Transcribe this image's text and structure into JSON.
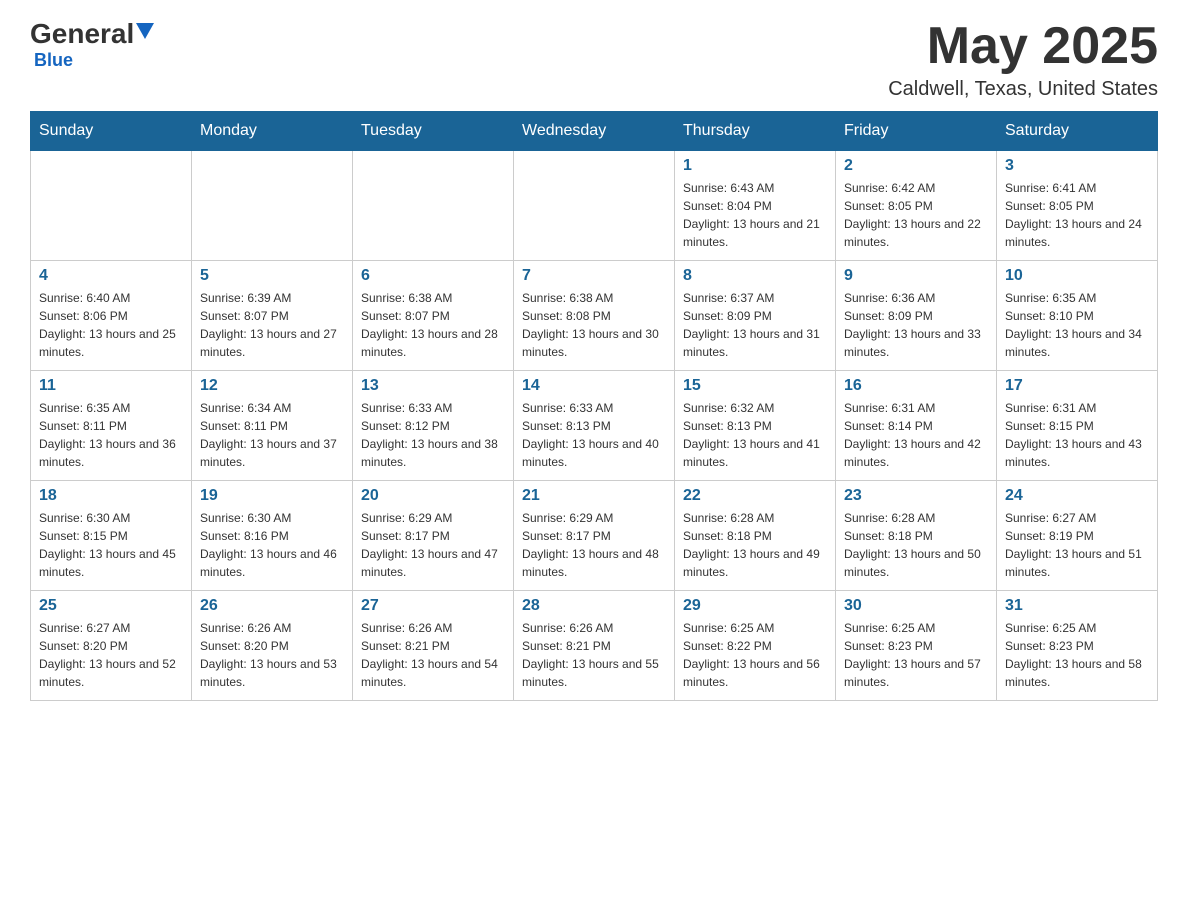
{
  "header": {
    "logo_general": "General",
    "logo_blue": "Blue",
    "month_title": "May 2025",
    "location": "Caldwell, Texas, United States"
  },
  "days_of_week": [
    "Sunday",
    "Monday",
    "Tuesday",
    "Wednesday",
    "Thursday",
    "Friday",
    "Saturday"
  ],
  "weeks": [
    [
      {
        "day": "",
        "info": ""
      },
      {
        "day": "",
        "info": ""
      },
      {
        "day": "",
        "info": ""
      },
      {
        "day": "",
        "info": ""
      },
      {
        "day": "1",
        "info": "Sunrise: 6:43 AM\nSunset: 8:04 PM\nDaylight: 13 hours and 21 minutes."
      },
      {
        "day": "2",
        "info": "Sunrise: 6:42 AM\nSunset: 8:05 PM\nDaylight: 13 hours and 22 minutes."
      },
      {
        "day": "3",
        "info": "Sunrise: 6:41 AM\nSunset: 8:05 PM\nDaylight: 13 hours and 24 minutes."
      }
    ],
    [
      {
        "day": "4",
        "info": "Sunrise: 6:40 AM\nSunset: 8:06 PM\nDaylight: 13 hours and 25 minutes."
      },
      {
        "day": "5",
        "info": "Sunrise: 6:39 AM\nSunset: 8:07 PM\nDaylight: 13 hours and 27 minutes."
      },
      {
        "day": "6",
        "info": "Sunrise: 6:38 AM\nSunset: 8:07 PM\nDaylight: 13 hours and 28 minutes."
      },
      {
        "day": "7",
        "info": "Sunrise: 6:38 AM\nSunset: 8:08 PM\nDaylight: 13 hours and 30 minutes."
      },
      {
        "day": "8",
        "info": "Sunrise: 6:37 AM\nSunset: 8:09 PM\nDaylight: 13 hours and 31 minutes."
      },
      {
        "day": "9",
        "info": "Sunrise: 6:36 AM\nSunset: 8:09 PM\nDaylight: 13 hours and 33 minutes."
      },
      {
        "day": "10",
        "info": "Sunrise: 6:35 AM\nSunset: 8:10 PM\nDaylight: 13 hours and 34 minutes."
      }
    ],
    [
      {
        "day": "11",
        "info": "Sunrise: 6:35 AM\nSunset: 8:11 PM\nDaylight: 13 hours and 36 minutes."
      },
      {
        "day": "12",
        "info": "Sunrise: 6:34 AM\nSunset: 8:11 PM\nDaylight: 13 hours and 37 minutes."
      },
      {
        "day": "13",
        "info": "Sunrise: 6:33 AM\nSunset: 8:12 PM\nDaylight: 13 hours and 38 minutes."
      },
      {
        "day": "14",
        "info": "Sunrise: 6:33 AM\nSunset: 8:13 PM\nDaylight: 13 hours and 40 minutes."
      },
      {
        "day": "15",
        "info": "Sunrise: 6:32 AM\nSunset: 8:13 PM\nDaylight: 13 hours and 41 minutes."
      },
      {
        "day": "16",
        "info": "Sunrise: 6:31 AM\nSunset: 8:14 PM\nDaylight: 13 hours and 42 minutes."
      },
      {
        "day": "17",
        "info": "Sunrise: 6:31 AM\nSunset: 8:15 PM\nDaylight: 13 hours and 43 minutes."
      }
    ],
    [
      {
        "day": "18",
        "info": "Sunrise: 6:30 AM\nSunset: 8:15 PM\nDaylight: 13 hours and 45 minutes."
      },
      {
        "day": "19",
        "info": "Sunrise: 6:30 AM\nSunset: 8:16 PM\nDaylight: 13 hours and 46 minutes."
      },
      {
        "day": "20",
        "info": "Sunrise: 6:29 AM\nSunset: 8:17 PM\nDaylight: 13 hours and 47 minutes."
      },
      {
        "day": "21",
        "info": "Sunrise: 6:29 AM\nSunset: 8:17 PM\nDaylight: 13 hours and 48 minutes."
      },
      {
        "day": "22",
        "info": "Sunrise: 6:28 AM\nSunset: 8:18 PM\nDaylight: 13 hours and 49 minutes."
      },
      {
        "day": "23",
        "info": "Sunrise: 6:28 AM\nSunset: 8:18 PM\nDaylight: 13 hours and 50 minutes."
      },
      {
        "day": "24",
        "info": "Sunrise: 6:27 AM\nSunset: 8:19 PM\nDaylight: 13 hours and 51 minutes."
      }
    ],
    [
      {
        "day": "25",
        "info": "Sunrise: 6:27 AM\nSunset: 8:20 PM\nDaylight: 13 hours and 52 minutes."
      },
      {
        "day": "26",
        "info": "Sunrise: 6:26 AM\nSunset: 8:20 PM\nDaylight: 13 hours and 53 minutes."
      },
      {
        "day": "27",
        "info": "Sunrise: 6:26 AM\nSunset: 8:21 PM\nDaylight: 13 hours and 54 minutes."
      },
      {
        "day": "28",
        "info": "Sunrise: 6:26 AM\nSunset: 8:21 PM\nDaylight: 13 hours and 55 minutes."
      },
      {
        "day": "29",
        "info": "Sunrise: 6:25 AM\nSunset: 8:22 PM\nDaylight: 13 hours and 56 minutes."
      },
      {
        "day": "30",
        "info": "Sunrise: 6:25 AM\nSunset: 8:23 PM\nDaylight: 13 hours and 57 minutes."
      },
      {
        "day": "31",
        "info": "Sunrise: 6:25 AM\nSunset: 8:23 PM\nDaylight: 13 hours and 58 minutes."
      }
    ]
  ]
}
